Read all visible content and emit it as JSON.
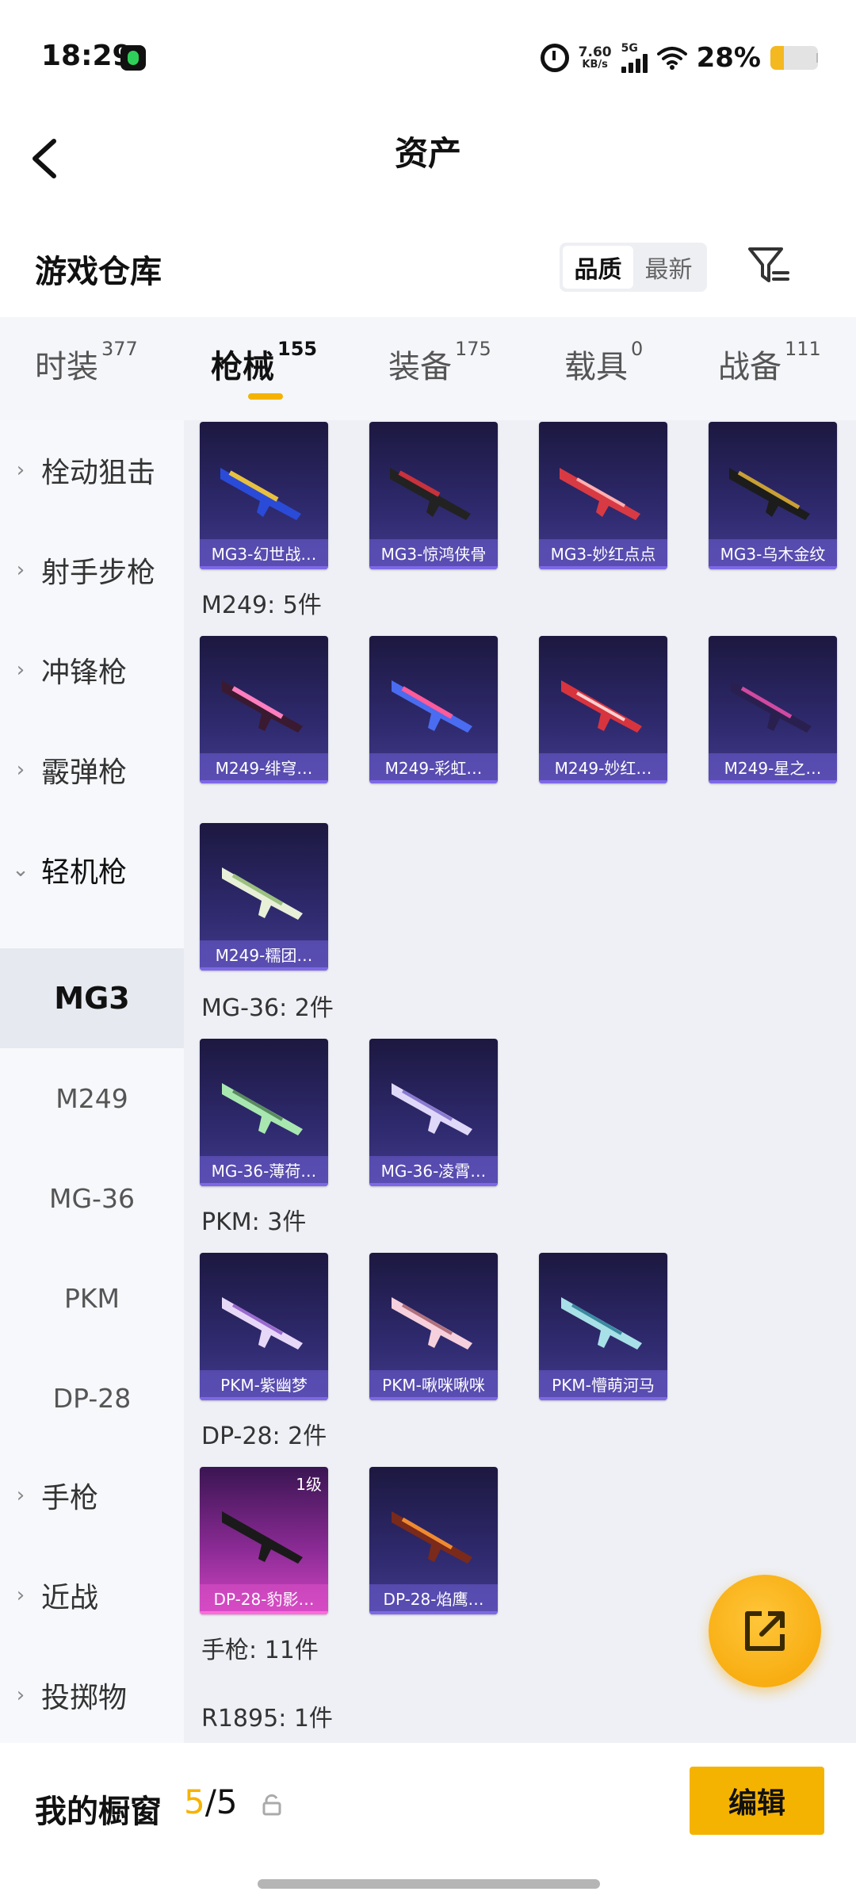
{
  "status": {
    "time": "18:29",
    "speed_value": "7.60",
    "speed_unit": "KB/s",
    "network": "5G",
    "battery_pct": "28%",
    "battery_level": 0.28,
    "accent": "#f5b301"
  },
  "header": {
    "title": "资产"
  },
  "warehouse": {
    "title": "游戏仓库",
    "sort_options": [
      "品质",
      "最新"
    ],
    "sort_selected": "品质"
  },
  "tabs": [
    {
      "label": "时装",
      "count": "377"
    },
    {
      "label": "枪械",
      "count": "155",
      "active": true
    },
    {
      "label": "装备",
      "count": "175"
    },
    {
      "label": "载具",
      "count": "0"
    },
    {
      "label": "战备",
      "count": "111"
    }
  ],
  "sidebar": {
    "items": [
      {
        "label": "栓动狙击"
      },
      {
        "label": "射手步枪"
      },
      {
        "label": "冲锋枪"
      },
      {
        "label": "霰弹枪"
      },
      {
        "label": "轻机枪",
        "expanded": true
      },
      {
        "label": "MG3",
        "sub": true,
        "active": true
      },
      {
        "label": "M249",
        "sub": true
      },
      {
        "label": "MG-36",
        "sub": true
      },
      {
        "label": "PKM",
        "sub": true
      },
      {
        "label": "DP-28",
        "sub": true
      },
      {
        "label": "手枪"
      },
      {
        "label": "近战"
      },
      {
        "label": "投掷物"
      }
    ]
  },
  "content": {
    "cards_mg3": [
      "MG3-幻世战…",
      "MG3-惊鸿侠骨",
      "MG3-妙红点点",
      "MG3-乌木金纹"
    ],
    "label_m249": "M249: 5件",
    "cards_m249": [
      "M249-绯穹…",
      "M249-彩虹…",
      "M249-妙红…",
      "M249-星之…",
      "M249-糯团…"
    ],
    "label_mg36": "MG-36: 2件",
    "cards_mg36": [
      "MG-36-薄荷…",
      "MG-36-凌霄…"
    ],
    "label_pkm": "PKM: 3件",
    "cards_pkm": [
      "PKM-紫幽梦",
      "PKM-啾咪啾咪",
      "PKM-懵萌河马"
    ],
    "label_dp28": "DP-28: 2件",
    "cards_dp28": [
      "DP-28-豹影…",
      "DP-28-焰鹰…"
    ],
    "dp28_level": "1级",
    "label_pistol": "手枪: 11件",
    "label_r1895": "R1895: 1件"
  },
  "bottom": {
    "showcase_label": "我的橱窗",
    "showcase_used": "5",
    "showcase_total": "/5",
    "edit_label": "编辑"
  }
}
